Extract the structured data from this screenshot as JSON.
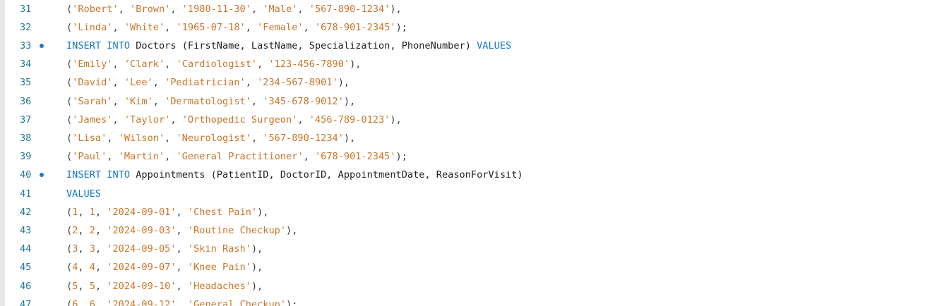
{
  "editor": {
    "lines": [
      {
        "number": "31",
        "dot": false,
        "tokens": [
          [
            "pn",
            "("
          ],
          [
            "str",
            "'Robert'"
          ],
          [
            "pn",
            ", "
          ],
          [
            "str",
            "'Brown'"
          ],
          [
            "pn",
            ", "
          ],
          [
            "str",
            "'1980-11-30'"
          ],
          [
            "pn",
            ", "
          ],
          [
            "str",
            "'Male'"
          ],
          [
            "pn",
            ", "
          ],
          [
            "str",
            "'567-890-1234'"
          ],
          [
            "pn",
            "),"
          ]
        ]
      },
      {
        "number": "32",
        "dot": false,
        "tokens": [
          [
            "pn",
            "("
          ],
          [
            "str",
            "'Linda'"
          ],
          [
            "pn",
            ", "
          ],
          [
            "str",
            "'White'"
          ],
          [
            "pn",
            ", "
          ],
          [
            "str",
            "'1965-07-18'"
          ],
          [
            "pn",
            ", "
          ],
          [
            "str",
            "'Female'"
          ],
          [
            "pn",
            ", "
          ],
          [
            "str",
            "'678-901-2345'"
          ],
          [
            "pn",
            ");"
          ]
        ]
      },
      {
        "number": "33",
        "dot": true,
        "tokens": [
          [
            "kw",
            "INSERT"
          ],
          [
            "pn",
            " "
          ],
          [
            "kw",
            "INTO"
          ],
          [
            "id",
            " Doctors (FirstName, LastName, Specialization, PhoneNumber) "
          ],
          [
            "kw",
            "VALUES"
          ]
        ]
      },
      {
        "number": "34",
        "dot": false,
        "tokens": [
          [
            "pn",
            "("
          ],
          [
            "str",
            "'Emily'"
          ],
          [
            "pn",
            ", "
          ],
          [
            "str",
            "'Clark'"
          ],
          [
            "pn",
            ", "
          ],
          [
            "str",
            "'Cardiologist'"
          ],
          [
            "pn",
            ", "
          ],
          [
            "str",
            "'123-456-7890'"
          ],
          [
            "pn",
            "),"
          ]
        ]
      },
      {
        "number": "35",
        "dot": false,
        "tokens": [
          [
            "pn",
            "("
          ],
          [
            "str",
            "'David'"
          ],
          [
            "pn",
            ", "
          ],
          [
            "str",
            "'Lee'"
          ],
          [
            "pn",
            ", "
          ],
          [
            "str",
            "'Pediatrician'"
          ],
          [
            "pn",
            ", "
          ],
          [
            "str",
            "'234-567-8901'"
          ],
          [
            "pn",
            "),"
          ]
        ]
      },
      {
        "number": "36",
        "dot": false,
        "tokens": [
          [
            "pn",
            "("
          ],
          [
            "str",
            "'Sarah'"
          ],
          [
            "pn",
            ", "
          ],
          [
            "str",
            "'Kim'"
          ],
          [
            "pn",
            ", "
          ],
          [
            "str",
            "'Dermatologist'"
          ],
          [
            "pn",
            ", "
          ],
          [
            "str",
            "'345-678-9012'"
          ],
          [
            "pn",
            "),"
          ]
        ]
      },
      {
        "number": "37",
        "dot": false,
        "tokens": [
          [
            "pn",
            "("
          ],
          [
            "str",
            "'James'"
          ],
          [
            "pn",
            ", "
          ],
          [
            "str",
            "'Taylor'"
          ],
          [
            "pn",
            ", "
          ],
          [
            "str",
            "'Orthopedic Surgeon'"
          ],
          [
            "pn",
            ", "
          ],
          [
            "str",
            "'456-789-0123'"
          ],
          [
            "pn",
            "),"
          ]
        ]
      },
      {
        "number": "38",
        "dot": false,
        "tokens": [
          [
            "pn",
            "("
          ],
          [
            "str",
            "'Lisa'"
          ],
          [
            "pn",
            ", "
          ],
          [
            "str",
            "'Wilson'"
          ],
          [
            "pn",
            ", "
          ],
          [
            "str",
            "'Neurologist'"
          ],
          [
            "pn",
            ", "
          ],
          [
            "str",
            "'567-890-1234'"
          ],
          [
            "pn",
            "),"
          ]
        ]
      },
      {
        "number": "39",
        "dot": false,
        "tokens": [
          [
            "pn",
            "("
          ],
          [
            "str",
            "'Paul'"
          ],
          [
            "pn",
            ", "
          ],
          [
            "str",
            "'Martin'"
          ],
          [
            "pn",
            ", "
          ],
          [
            "str",
            "'General Practitioner'"
          ],
          [
            "pn",
            ", "
          ],
          [
            "str",
            "'678-901-2345'"
          ],
          [
            "pn",
            ");"
          ]
        ]
      },
      {
        "number": "40",
        "dot": true,
        "tokens": [
          [
            "kw",
            "INSERT"
          ],
          [
            "pn",
            " "
          ],
          [
            "kw",
            "INTO"
          ],
          [
            "id",
            " Appointments (PatientID, DoctorID, AppointmentDate, ReasonForVisit)"
          ]
        ]
      },
      {
        "number": "41",
        "dot": false,
        "tokens": [
          [
            "kw",
            "VALUES"
          ]
        ]
      },
      {
        "number": "42",
        "dot": false,
        "tokens": [
          [
            "pn",
            "("
          ],
          [
            "num",
            "1"
          ],
          [
            "pn",
            ", "
          ],
          [
            "num",
            "1"
          ],
          [
            "pn",
            ", "
          ],
          [
            "str",
            "'2024-09-01'"
          ],
          [
            "pn",
            ", "
          ],
          [
            "str",
            "'Chest Pain'"
          ],
          [
            "pn",
            "),"
          ]
        ]
      },
      {
        "number": "43",
        "dot": false,
        "tokens": [
          [
            "pn",
            "("
          ],
          [
            "num",
            "2"
          ],
          [
            "pn",
            ", "
          ],
          [
            "num",
            "2"
          ],
          [
            "pn",
            ", "
          ],
          [
            "str",
            "'2024-09-03'"
          ],
          [
            "pn",
            ", "
          ],
          [
            "str",
            "'Routine Checkup'"
          ],
          [
            "pn",
            "),"
          ]
        ]
      },
      {
        "number": "44",
        "dot": false,
        "tokens": [
          [
            "pn",
            "("
          ],
          [
            "num",
            "3"
          ],
          [
            "pn",
            ", "
          ],
          [
            "num",
            "3"
          ],
          [
            "pn",
            ", "
          ],
          [
            "str",
            "'2024-09-05'"
          ],
          [
            "pn",
            ", "
          ],
          [
            "str",
            "'Skin Rash'"
          ],
          [
            "pn",
            "),"
          ]
        ]
      },
      {
        "number": "45",
        "dot": false,
        "tokens": [
          [
            "pn",
            "("
          ],
          [
            "num",
            "4"
          ],
          [
            "pn",
            ", "
          ],
          [
            "num",
            "4"
          ],
          [
            "pn",
            ", "
          ],
          [
            "str",
            "'2024-09-07'"
          ],
          [
            "pn",
            ", "
          ],
          [
            "str",
            "'Knee Pain'"
          ],
          [
            "pn",
            "),"
          ]
        ]
      },
      {
        "number": "46",
        "dot": false,
        "tokens": [
          [
            "pn",
            "("
          ],
          [
            "num",
            "5"
          ],
          [
            "pn",
            ", "
          ],
          [
            "num",
            "5"
          ],
          [
            "pn",
            ", "
          ],
          [
            "str",
            "'2024-09-10'"
          ],
          [
            "pn",
            ", "
          ],
          [
            "str",
            "'Headaches'"
          ],
          [
            "pn",
            "),"
          ]
        ]
      },
      {
        "number": "47",
        "dot": false,
        "tokens": [
          [
            "pn",
            "("
          ],
          [
            "num",
            "6"
          ],
          [
            "pn",
            ", "
          ],
          [
            "num",
            "6"
          ],
          [
            "pn",
            ", "
          ],
          [
            "str",
            "'2024-09-12'"
          ],
          [
            "pn",
            ", "
          ],
          [
            "str",
            "'General Checkup'"
          ],
          [
            "pn",
            ");"
          ]
        ]
      }
    ]
  },
  "colors": {
    "line_number": "#237893",
    "keyword": "#1475c4",
    "string": "#c9762a",
    "identifier": "#1f1f1f",
    "statement_dot": "#1f75c8",
    "background": "#ffffff",
    "left_bar": "#e7e7e7"
  }
}
